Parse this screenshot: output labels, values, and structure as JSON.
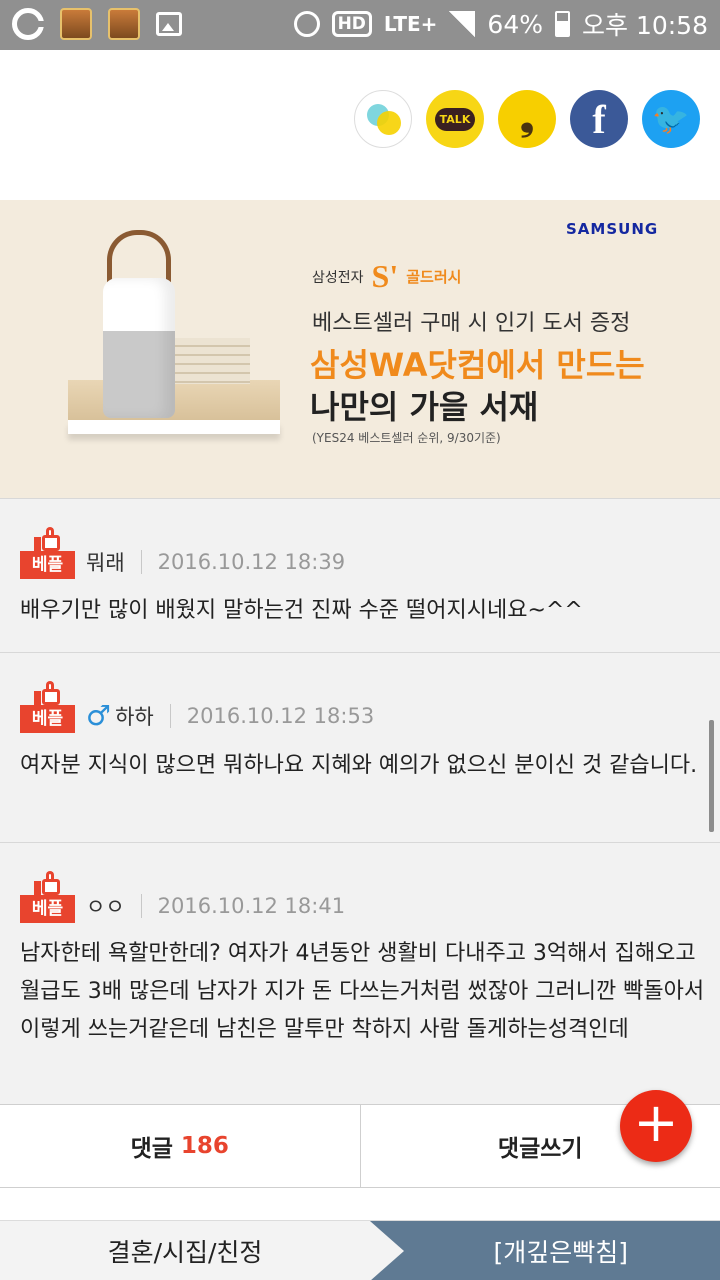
{
  "status_bar": {
    "battery": "64%",
    "time": "오후 10:58",
    "hd": "HD",
    "lte": "LTE+",
    "app_label": "netmarble"
  },
  "share": {
    "kakao_label": "TALK",
    "story_glyph": "❟",
    "facebook_glyph": "f",
    "twitter_glyph": "🐦"
  },
  "ad": {
    "samsung": "SAMSUNG",
    "brand": "삼성전자",
    "s_logo": "S'",
    "gold": "골드러시",
    "line1": "베스트셀러 구매 시 인기 도서 증정",
    "line2": "삼성WA닷컴에서 만드는",
    "line3": "나만의 가을 서재",
    "note": "(YES24 베스트셀러 순위, 9/30기준)"
  },
  "comments": [
    {
      "badge": "베플",
      "author": "뭐래",
      "gender": "",
      "date": "2016.10.12 18:39",
      "text": "배우기만 많이 배웠지 말하는건 진짜 수준 떨어지시네요~^^"
    },
    {
      "badge": "베플",
      "author": "하하",
      "gender": "♂",
      "date": "2016.10.12 18:53",
      "text": "여자분 지식이 많으면 뭐하나요 지혜와 예의가 없으신 분이신 것 같습니다."
    },
    {
      "badge": "베플",
      "author": "ㅇㅇ",
      "gender": "",
      "date": "2016.10.12 18:41",
      "text": "남자한테 욕할만한데? 여자가 4년동안 생활비 다내주고 3억해서 집해오고 월급도 3배 많은데 남자가 지가 돈 다쓰는거처럼 썼잖아 그러니깐 빡돌아서 이렇게 쓰는거같은데 남친은 말투만 착하지 사람 돌게하는성격인데"
    }
  ],
  "actions": {
    "comments_label": "댓글",
    "comments_count": "186",
    "write_label": "댓글쓰기",
    "fab": "+"
  },
  "category": {
    "left": "결혼/시집/친정",
    "right": "[개깊은빡침]"
  },
  "colors": {
    "accent": "#e8442e",
    "nav": "#5f7a93",
    "ad_orange": "#f08a1c"
  }
}
